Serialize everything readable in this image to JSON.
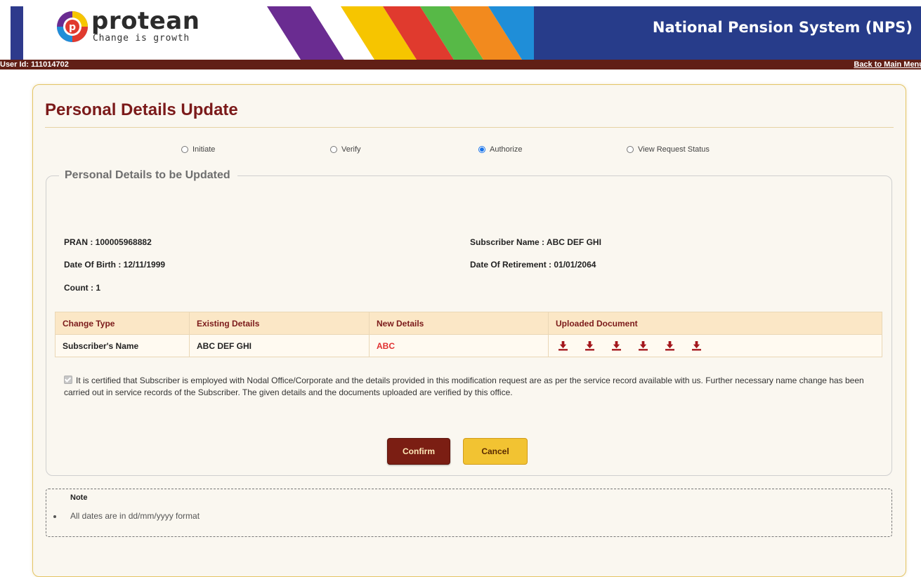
{
  "header": {
    "logo_name": "protean",
    "logo_tagline": "Change is growth",
    "app_title": "National Pension System (NPS)",
    "brand_stripe_colors": [
      "#6a2c91",
      "#f6c500",
      "#e03a2e",
      "#57b947",
      "#f28a1e",
      "#1f8ed8"
    ],
    "brand_band_color": "#273c8a"
  },
  "userbar": {
    "user_id_text": "User Id: 111014702",
    "back_link": "Back to Main Menu"
  },
  "page": {
    "title": "Personal Details Update"
  },
  "steps": [
    {
      "label": "Initiate",
      "selected": false
    },
    {
      "label": "Verify",
      "selected": false
    },
    {
      "label": "Authorize",
      "selected": true
    },
    {
      "label": "View Request Status",
      "selected": false
    }
  ],
  "section": {
    "legend": "Personal Details to be Updated"
  },
  "subscriber": {
    "pran": "PRAN : 100005968882",
    "name": "Subscriber Name : ABC DEF GHI",
    "dob": "Date Of Birth : 12/11/1999",
    "retirement": "Date Of Retirement : 01/01/2064",
    "count": "Count : 1"
  },
  "table": {
    "headers": [
      "Change Type",
      "Existing Details",
      "New Details",
      "Uploaded Document"
    ],
    "rows": [
      {
        "change_type": "Subscriber's Name",
        "existing": "ABC DEF GHI",
        "new": "ABC",
        "document_count": 6,
        "document_icon": "download-icon"
      }
    ]
  },
  "certification": {
    "checked": true,
    "text": "It is certified that Subscriber is employed with Nodal Office/Corporate and the details provided in this modification request are as per the service record available with us. Further necessary name change has been carried out in service records of the Subscriber. The given details and the documents uploaded are verified by this office."
  },
  "buttons": {
    "confirm": "Confirm",
    "cancel": "Cancel"
  },
  "note": {
    "title": "Note",
    "items": [
      "All dates are in dd/mm/yyyy format"
    ]
  },
  "colors": {
    "title": "#7b1a1a",
    "userbar": "#611f16",
    "confirm_button": "#7b1e13",
    "cancel_button": "#f2c332",
    "new_value": "#e03030"
  }
}
